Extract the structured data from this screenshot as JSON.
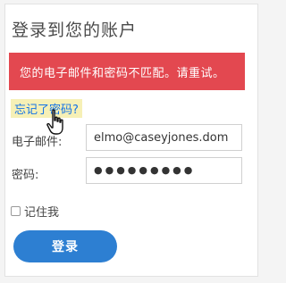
{
  "header": {
    "title": "登录到您的账户"
  },
  "error": {
    "message": "您的电子邮件和密码不匹配。请重试。",
    "color": "#e34850"
  },
  "forgot_link": "忘记了密码?",
  "form": {
    "email_label": "电子邮件:",
    "email_value": "elmo@caseyjones.dom",
    "password_label": "密码:",
    "password_value": "●●●●●●●●●",
    "remember_label": "记住我",
    "submit_label": "登录"
  },
  "colors": {
    "accent": "#2d7fd2",
    "link": "#1473e6",
    "highlight": "#f6f0b6"
  }
}
